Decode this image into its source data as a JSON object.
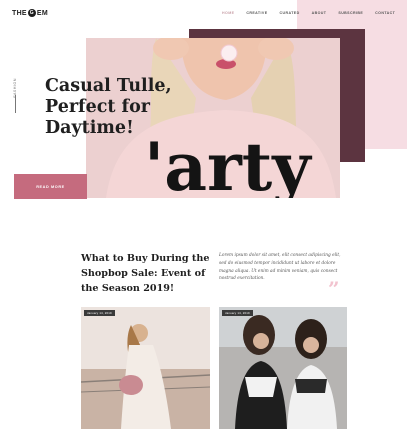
{
  "header": {
    "logo_left": "THE",
    "logo_mark": "G",
    "logo_right": "EM",
    "nav": [
      "HOME",
      "CREATIVE",
      "CURATED",
      "ABOUT",
      "SUBSCRIBE",
      "CONTACT"
    ],
    "active_nav": "HOME"
  },
  "hero": {
    "side_label": "FASHION",
    "title": "Casual Tulle, Perfect for Daytime!",
    "image_text": "'arty",
    "cta_label": "READ MORE"
  },
  "article": {
    "title": "What to Buy During the Shopbop Sale: Event of the Season 2019!",
    "excerpt": "Lorem ipsum dolor sit amet, elit consect adipiscing elit, sed do eiusmod tempor incididunt ut labore et dolore magna aliqua. Ut enim ad minim veniam, quis consect nostrud exercitation.",
    "quote_glyph": "”"
  },
  "cards": [
    {
      "date": "January 14, 2019"
    },
    {
      "date": "January 14, 2019"
    }
  ],
  "colors": {
    "accent_pink": "#c56b7e",
    "light_pink": "#f6dde3",
    "dark_plum": "#5c3440"
  }
}
